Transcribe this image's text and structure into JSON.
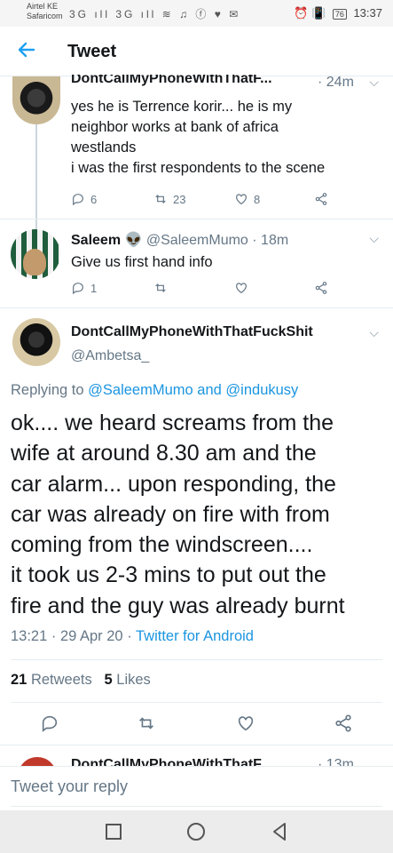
{
  "status_bar": {
    "carrier_1": "Airtel KE",
    "carrier_2": "Safaricom",
    "icons": "3G ıll 3G ıll ≋ ♫ ⓕ ♥ ✉",
    "battery": "76",
    "time": "13:37"
  },
  "header": {
    "title": "Tweet"
  },
  "tweets": [
    {
      "name": "DontCallMyPhoneWithThatF...",
      "time": "· 24m",
      "lines": [
        "yes he is Terrence korir... he is my",
        "neighbor works at bank of africa",
        "westlands",
        "i was the first respondents to the scene"
      ],
      "replies": "6",
      "retweets": "23",
      "likes": "8"
    },
    {
      "name": "Saleem",
      "emoji": "👽",
      "handle": "@SaleemMumo",
      "time": "· 18m",
      "lines": [
        "Give us first hand info"
      ],
      "replies": "1",
      "retweets": "",
      "likes": ""
    }
  ],
  "main_tweet": {
    "name": "DontCallMyPhoneWithThatFuckShit",
    "handle": "@Ambetsa_",
    "replying_prefix": "Replying to",
    "replying_user_1": "@SaleemMumo",
    "replying_and": "and",
    "replying_user_2": "@indukusy",
    "lines": [
      "ok.... we heard screams from the",
      "wife at around 8.30 am and the",
      "car alarm... upon responding, the",
      "car was already on fire with from",
      "coming from the windscreen....",
      "it took us 2-3 mins to put out the",
      "fire and the guy was already burnt"
    ],
    "time": "13:21",
    "date": "· 29 Apr 20 ·",
    "source": "Twitter for Android",
    "retweets_count": "21",
    "retweets_label": "Retweets",
    "likes_count": "5",
    "likes_label": "Likes"
  },
  "next_tweet": {
    "name": "DontCallMyPhoneWithThatF...",
    "time": "· 13m"
  },
  "reply_bar": {
    "placeholder": "Tweet your reply"
  }
}
